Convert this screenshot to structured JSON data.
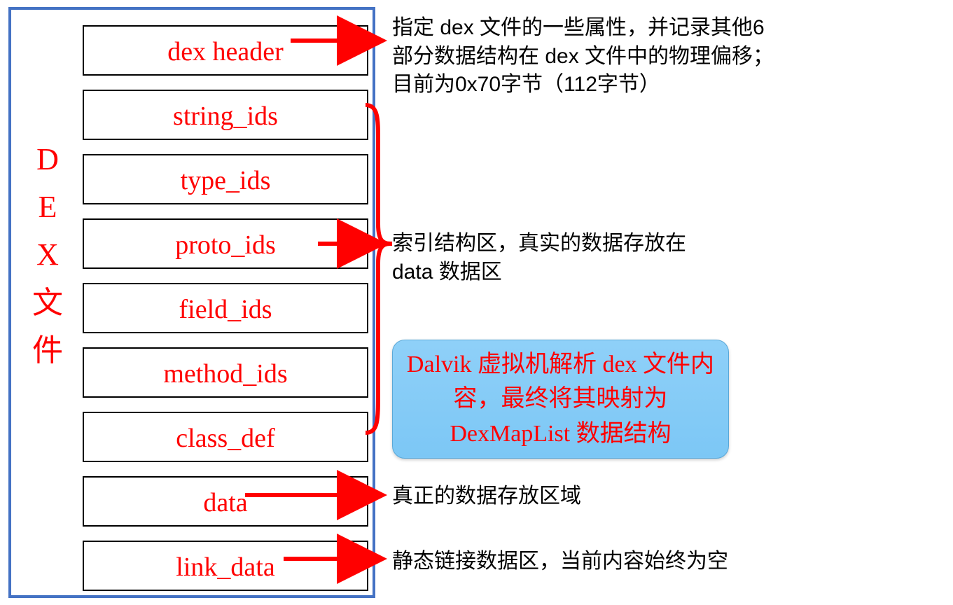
{
  "vert_label": [
    "D",
    "E",
    "X",
    "文",
    "件"
  ],
  "sections": {
    "dex_header": "dex header",
    "string_ids": "string_ids",
    "type_ids": "type_ids",
    "proto_ids": "proto_ids",
    "field_ids": "field_ids",
    "method_ids": "method_ids",
    "class_def": "class_def",
    "data": "data",
    "link_data": "link_data"
  },
  "desc": {
    "header": "指定 dex 文件的一些属性，并记录其他6部分数据结构在 dex 文件中的物理偏移；目前为0x70字节（112字节）",
    "index": "索引结构区，真实的数据存放在 data 数据区",
    "data": "真正的数据存放区域",
    "link": "静态链接数据区，当前内容始终为空"
  },
  "callout": "Dalvik 虚拟机解析 dex 文件内容，最终将其映射为 DexMapList 数据结构"
}
